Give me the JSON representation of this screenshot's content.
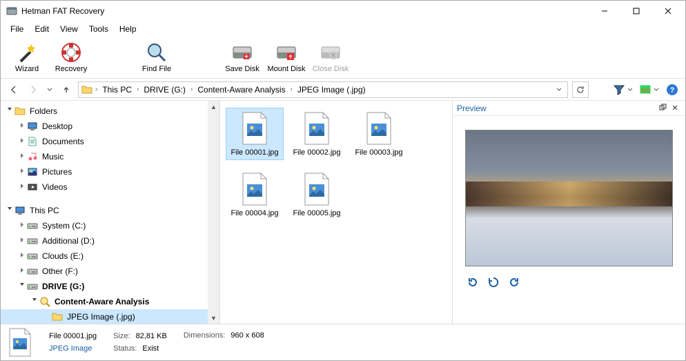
{
  "window": {
    "title": "Hetman FAT Recovery"
  },
  "menu": [
    "File",
    "Edit",
    "View",
    "Tools",
    "Help"
  ],
  "toolbar": [
    {
      "label": "Wizard"
    },
    {
      "label": "Recovery"
    },
    {
      "label": "Find File"
    },
    {
      "label": "Save Disk"
    },
    {
      "label": "Mount Disk"
    },
    {
      "label": "Close Disk"
    }
  ],
  "breadcrumb": [
    "This PC",
    "DRIVE (G:)",
    "Content-Aware Analysis",
    "JPEG Image (.jpg)"
  ],
  "tree": {
    "root1": "Folders",
    "folders": [
      "Desktop",
      "Documents",
      "Music",
      "Pictures",
      "Videos"
    ],
    "root2": "This PC",
    "drives": [
      "System (C:)",
      "Additional (D:)",
      "Clouds (E:)",
      "Other (F:)",
      "DRIVE (G:)"
    ],
    "analysis": "Content-Aware Analysis",
    "leaf": "JPEG Image (.jpg)"
  },
  "files": [
    "File 00001.jpg",
    "File 00002.jpg",
    "File 00003.jpg",
    "File 00004.jpg",
    "File 00005.jpg"
  ],
  "preview": {
    "title": "Preview"
  },
  "status": {
    "name": "File 00001.jpg",
    "type": "JPEG Image",
    "sizeLabel": "Size:",
    "size": "82,81 KB",
    "statusLabel": "Status:",
    "status": "Exist",
    "dimLabel": "Dimensions:",
    "dim": "960 x 608"
  }
}
